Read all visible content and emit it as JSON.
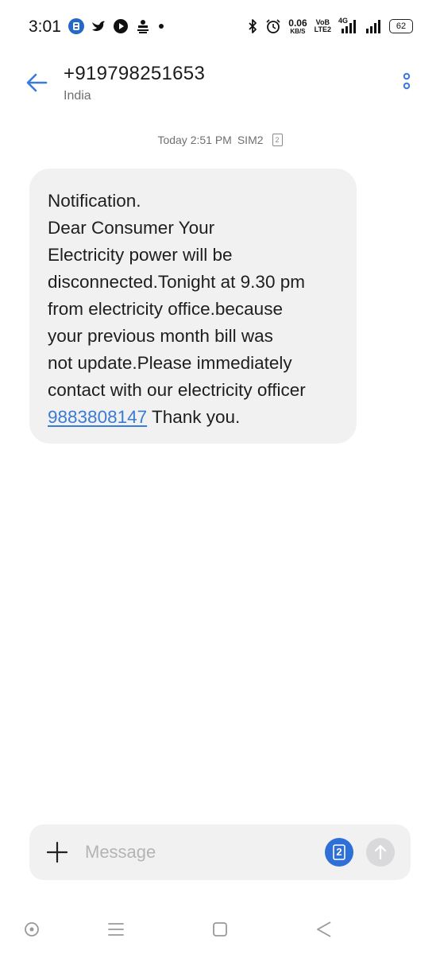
{
  "status_bar": {
    "time": "3:01",
    "network_speed": "0.06",
    "network_speed_unit": "KB/S",
    "volte_top": "VoB",
    "volte_bottom": "LTE2",
    "network_type": "4G",
    "battery_level": "62",
    "left_icons": [
      "bank-app-icon",
      "bird-app-icon",
      "play-app-icon",
      "hindi-news-app-icon",
      "more-notifications-dot"
    ],
    "right_icons": [
      "bluetooth-icon",
      "alarm-icon",
      "signal-sim1-icon",
      "signal-sim2-icon",
      "battery-icon"
    ]
  },
  "header": {
    "contact_number": "+919798251653",
    "contact_region": "India",
    "back_icon": "back-arrow-icon",
    "more_icon": "more-options-icon"
  },
  "conversation": {
    "timestamp": "Today 2:51 PM",
    "sim_label": "SIM2",
    "sim_badge": "2",
    "message": {
      "lines": [
        "Notification.",
        "Dear Consumer Your",
        "Electricity power will be",
        "disconnected.Tonight at 9.30 pm",
        "from electricity office.because",
        "your previous month bill was",
        "not update.Please immediately",
        "contact with our electricity officer"
      ],
      "phone_link": "9883808147",
      "closing": " Thank you."
    }
  },
  "composer": {
    "placeholder": "Message",
    "value": "",
    "sim_number": "2",
    "attach_icon": "plus-icon",
    "send_icon": "send-arrow-icon"
  },
  "nav_bar": {
    "icons": [
      "assistant-icon",
      "menu-icon",
      "home-square-icon",
      "back-triangle-icon"
    ]
  },
  "colors": {
    "accent": "#2f70d8",
    "link": "#3a7bd5",
    "bubble": "#f1f1f2",
    "secondary_text": "#6f6f6f"
  }
}
